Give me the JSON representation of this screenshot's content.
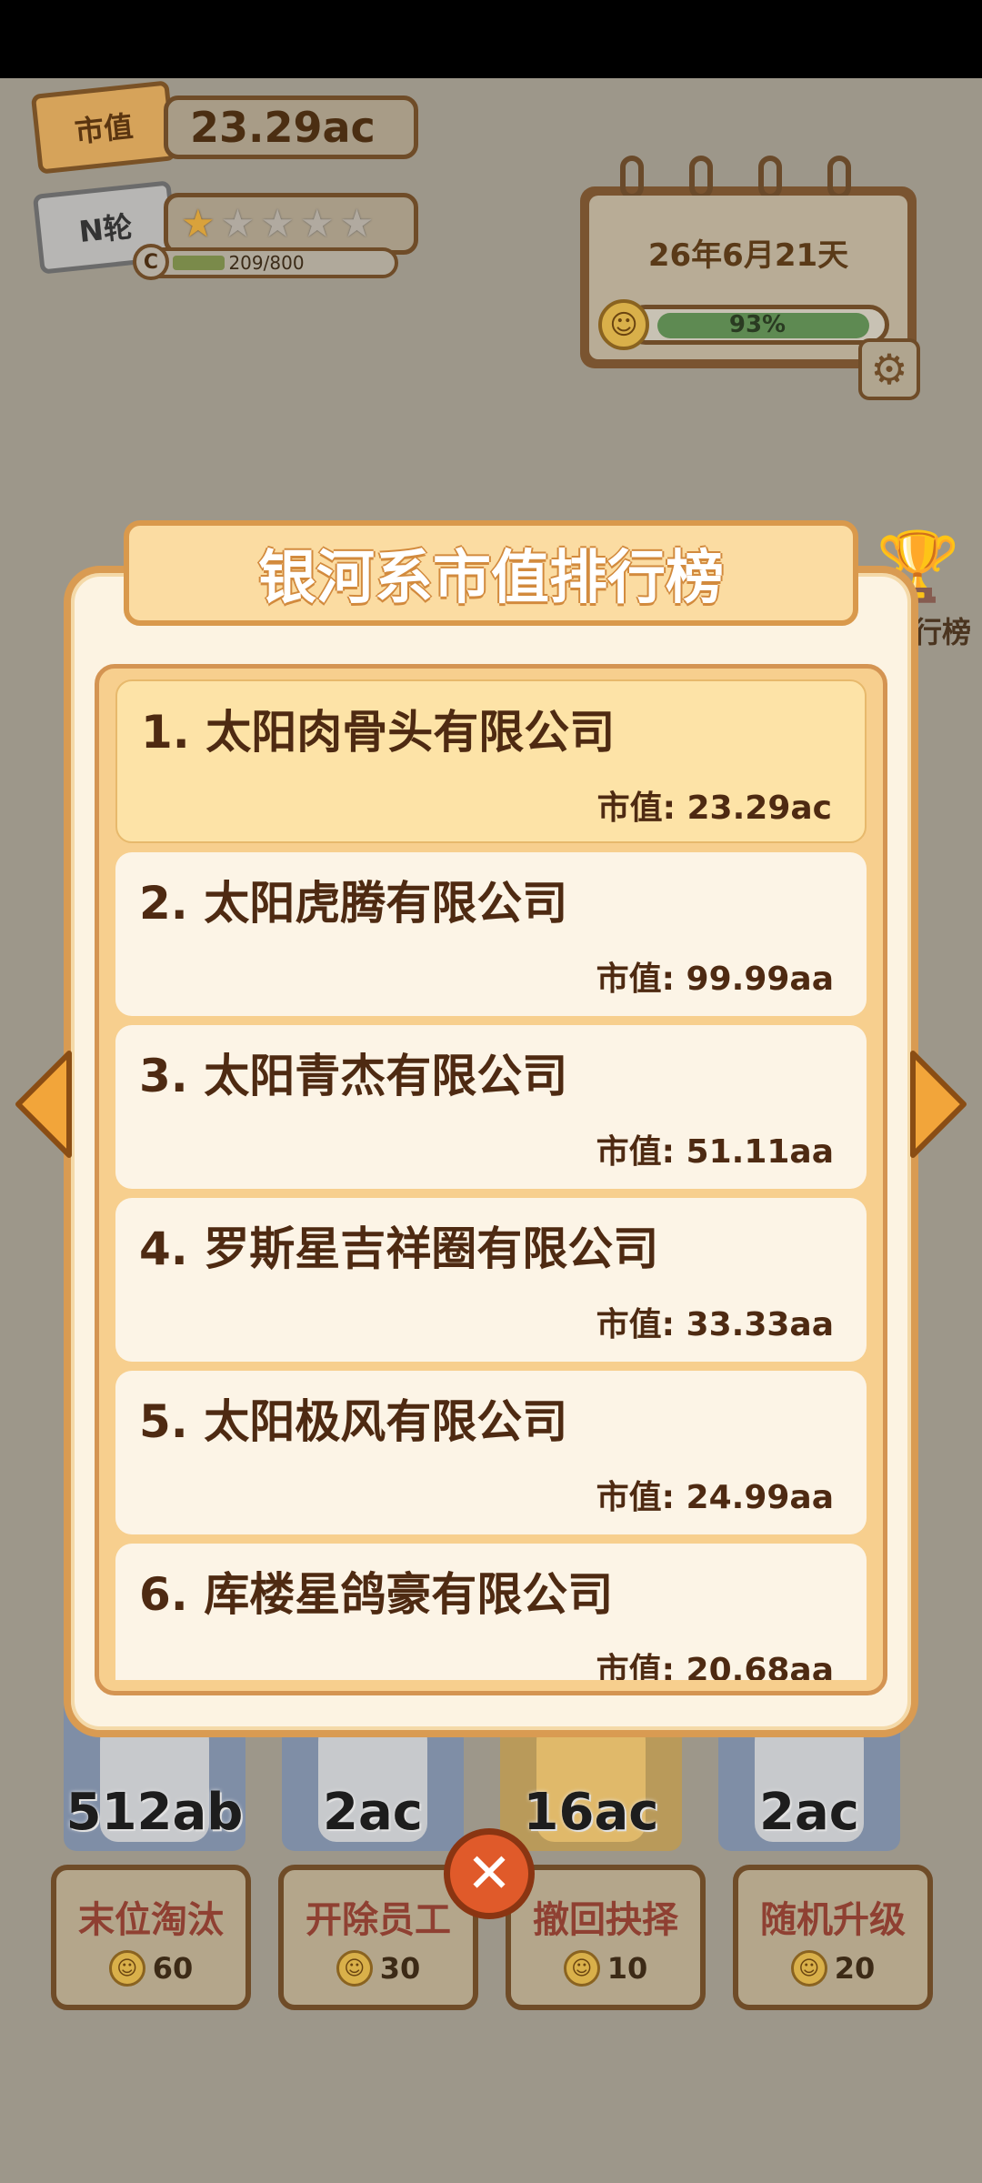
{
  "hud": {
    "market_tag": "市值",
    "market_value": "23.29ac",
    "round_tag": "N轮",
    "stars_total": 5,
    "stars_filled": 1,
    "xp_badge": "C",
    "xp_text": "209/800",
    "xp_progress": 0.26,
    "date": "26年6月21天",
    "mood_percent": "93%",
    "mood_progress": 0.93,
    "leaderboard_label": "行榜"
  },
  "modal": {
    "title": "银河系市值排行榜",
    "entries": [
      {
        "name": "1. 太阳肉骨头有限公司",
        "value": "市值: 23.29ac"
      },
      {
        "name": "2. 太阳虎腾有限公司",
        "value": "市值: 99.99aa"
      },
      {
        "name": "3. 太阳青杰有限公司",
        "value": "市值: 51.11aa"
      },
      {
        "name": "4. 罗斯星吉祥圈有限公司",
        "value": "市值: 33.33aa"
      },
      {
        "name": "5. 太阳极风有限公司",
        "value": "市值: 24.99aa"
      },
      {
        "name": "6. 库楼星鸽豪有限公司",
        "value": "市值: 20.68aa"
      }
    ]
  },
  "employees": [
    "512ab",
    "2ac",
    "16ac",
    "2ac"
  ],
  "actions": [
    {
      "label": "末位淘汰",
      "cost": "60"
    },
    {
      "label": "开除员工",
      "cost": "30"
    },
    {
      "label": "撤回抉择",
      "cost": "10"
    },
    {
      "label": "随机升级",
      "cost": "20"
    }
  ],
  "icons": {
    "close": "close-icon",
    "settings": "gear-icon",
    "trophy": "trophy-icon",
    "smile": "smile-icon",
    "arrow_left": "arrow-left-icon",
    "arrow_right": "arrow-right-icon"
  },
  "colors": {
    "accent": "#d99b52",
    "close_button": "#e05a2a",
    "action_label": "#8f4032"
  }
}
